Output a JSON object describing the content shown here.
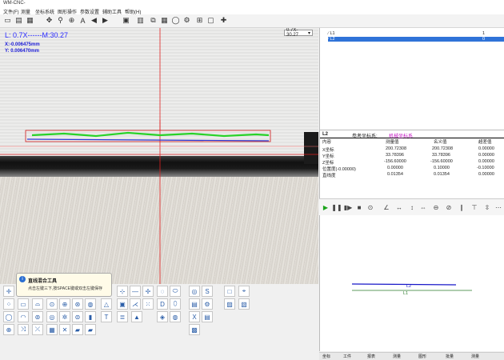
{
  "window": {
    "title": "WM-CNC-"
  },
  "menu": [
    "文件(F)",
    "测量",
    "坐标系统",
    "图形操作",
    "参数设置",
    "辅助工具",
    "帮助(H)"
  ],
  "camera": {
    "lens": "L: 0.7X------M:30.27",
    "x_coord": "X:-0.006475mm",
    "y_coord": "Y: 0.006470mm",
    "zoom_label": "0.7X-30.27"
  },
  "feature_list": [
    {
      "icon": "line-icon",
      "label": "L1",
      "value": "1"
    },
    {
      "icon": "line-icon",
      "label": "L2",
      "value": "0",
      "selected": true
    }
  ],
  "properties": {
    "feature": "L2",
    "coord_label": "参考坐标系:",
    "coord_value": "机械坐标系",
    "headers": [
      "内容",
      "测量值",
      "名义值",
      "超差值"
    ],
    "rows": [
      [
        "X坐标",
        "200.72308",
        "200.72308",
        "0.00000"
      ],
      [
        "Y坐标",
        "33.78396",
        "33.78396",
        "0.00000"
      ],
      [
        "Z坐标",
        "-156.60000",
        "-156.60000",
        "0.00000"
      ],
      [
        "位置度(-0.00000)",
        "0.00000",
        "0.10000",
        "-0.10000"
      ],
      [
        "直线度",
        "0.01354",
        "0.01354",
        "0.00000"
      ]
    ]
  },
  "preview": {
    "label_l2": "L2",
    "label_l1": "L1"
  },
  "tooltip": {
    "title": "直线混合工具",
    "body": "点击左键三下,按SPACE键或双击左键保存"
  },
  "bottom_tabs": [
    "坐标",
    "工件",
    "报表",
    "测量",
    "图形",
    "批量",
    "测量"
  ]
}
